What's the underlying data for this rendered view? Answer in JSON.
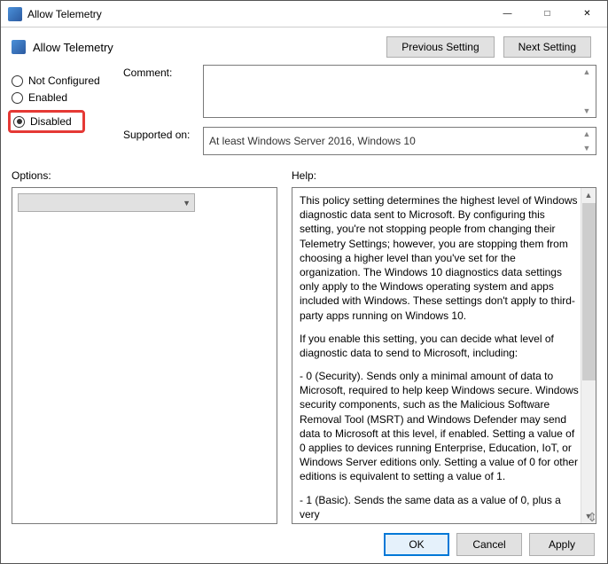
{
  "window": {
    "title": "Allow Telemetry"
  },
  "header": {
    "title": "Allow Telemetry",
    "prev_btn": "Previous Setting",
    "next_btn": "Next Setting"
  },
  "radios": {
    "not_configured": "Not Configured",
    "enabled": "Enabled",
    "disabled": "Disabled",
    "selected": "disabled"
  },
  "fields": {
    "comment_label": "Comment:",
    "comment_value": "",
    "supported_label": "Supported on:",
    "supported_value": "At least Windows Server 2016, Windows 10"
  },
  "sections": {
    "options_label": "Options:",
    "help_label": "Help:"
  },
  "help": {
    "p1": "This policy setting determines the highest level of Windows diagnostic data sent to Microsoft. By configuring this setting, you're not stopping people from changing their Telemetry Settings; however, you are stopping them from choosing a higher level than you've set for the organization. The Windows 10 diagnostics data settings only apply to the Windows operating system and apps included with Windows. These settings don't apply to third-party apps running on Windows 10.",
    "p2": "If you enable this setting, you can decide what level of diagnostic data to send to Microsoft, including:",
    "p3": "  - 0 (Security). Sends only a minimal amount of data to Microsoft, required to help keep Windows secure. Windows security components, such as the Malicious Software Removal Tool (MSRT) and Windows Defender may send data to Microsoft at this level, if enabled. Setting a value of 0 applies to devices running Enterprise, Education, IoT, or Windows Server editions only. Setting a value of 0 for other editions is equivalent to setting a value of 1.",
    "p4": "  - 1 (Basic). Sends the same data as a value of 0, plus a very"
  },
  "footer": {
    "ok": "OK",
    "cancel": "Cancel",
    "apply": "Apply"
  }
}
